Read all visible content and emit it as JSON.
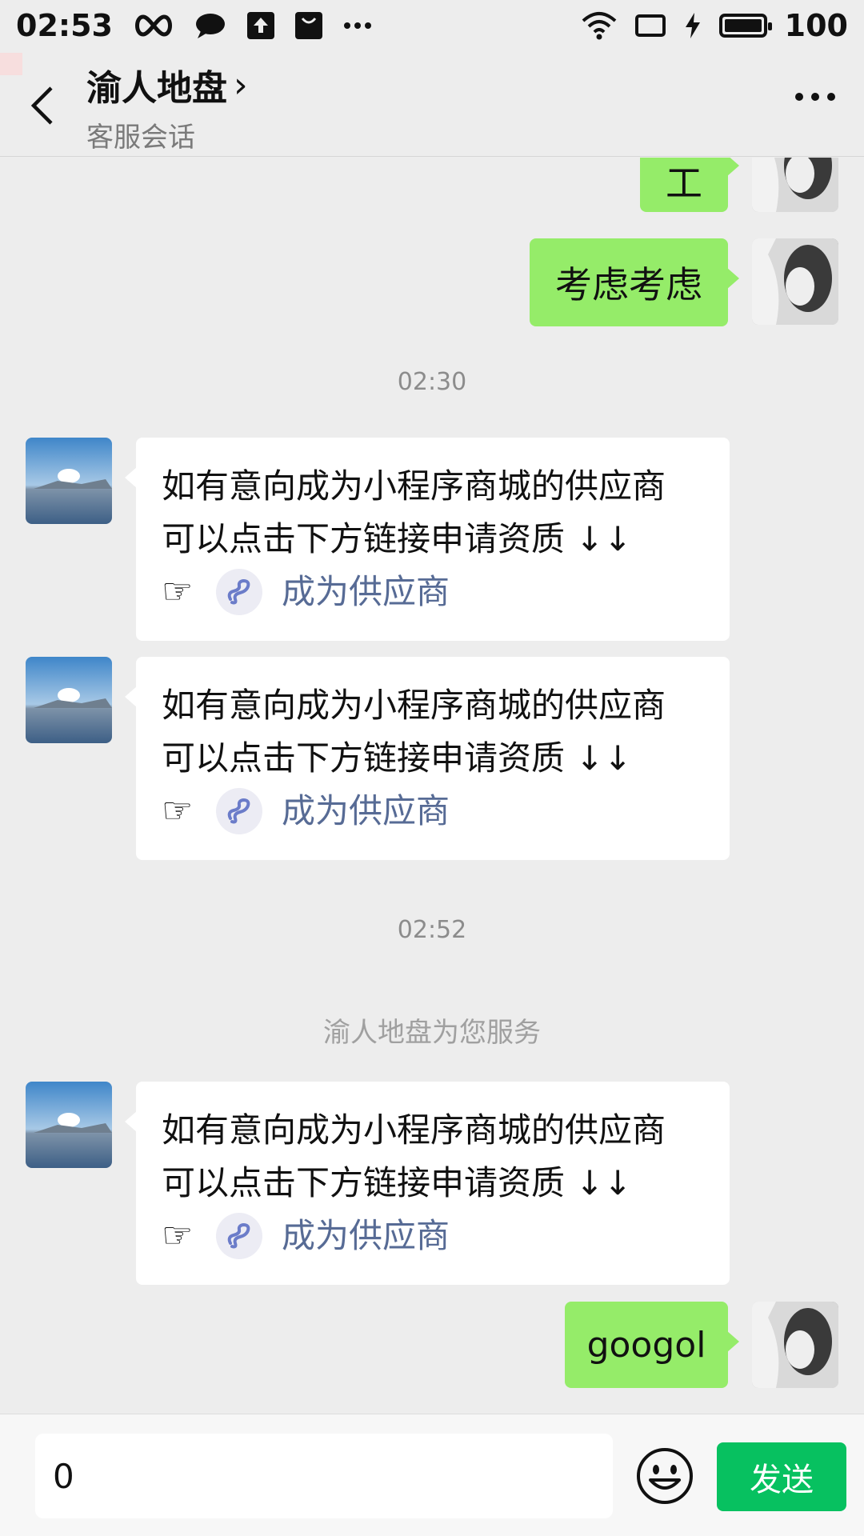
{
  "status_bar": {
    "time": "02:53",
    "battery_level": "100",
    "icons": [
      "infinity-icon",
      "chat-bubble-icon",
      "upload-icon",
      "bag-icon",
      "more-dots-icon",
      "wifi-icon",
      "screen-icon",
      "charging-icon",
      "battery-icon"
    ]
  },
  "header": {
    "title": "渝人地盘",
    "chevron": "›",
    "subtitle": "客服会话"
  },
  "messages": {
    "m1": {
      "text": "工"
    },
    "m2": {
      "text": "考虑考虑"
    },
    "time1": "02:30",
    "m3": {
      "line1": "如有意向成为小程序商城的供应商",
      "line2": "可以点击下方链接申请资质 ↓↓",
      "hand": "☞",
      "link": "成为供应商"
    },
    "m4": {
      "line1": "如有意向成为小程序商城的供应商",
      "line2": "可以点击下方链接申请资质 ↓↓",
      "hand": "☞",
      "link": "成为供应商"
    },
    "time2": "02:52",
    "system": "渝人地盘为您服务",
    "m5": {
      "line1": "如有意向成为小程序商城的供应商",
      "line2": "可以点击下方链接申请资质 ↓↓",
      "hand": "☞",
      "link": "成为供应商"
    },
    "m6": {
      "text": "googol"
    }
  },
  "input": {
    "value": "0",
    "send_label": "发送"
  },
  "colors": {
    "background": "#ededed",
    "self_bubble": "#95ec69",
    "other_bubble": "#ffffff",
    "link": "#576b95",
    "send_button": "#07c160"
  }
}
